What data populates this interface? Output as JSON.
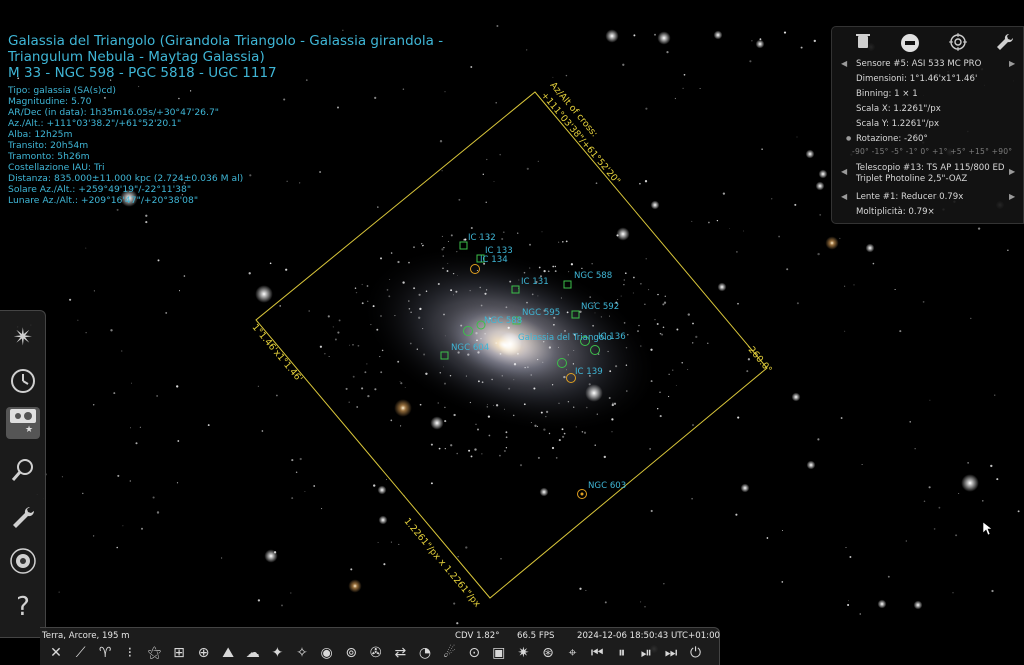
{
  "object": {
    "title_lines": [
      "Galassia del Triangolo (Girandola Triangolo - Galassia girandola -",
      "Triangulum Nebula - Maytag Galassia)",
      "M 33 - NGC 598 - PGC 5818 - UGC 1117"
    ],
    "details": [
      "Tipo: galassia (SA(s)cd)",
      "Magnitudine: 5.70",
      "AR/Dec (in data): 1h35m16.05s/+30°47'26.7\"",
      "Az./Alt.: +111°03'38.2\"/+61°52'20.1\"",
      "Alba: 12h25m",
      "Transito: 20h54m",
      "Tramonto: 5h26m",
      "Costellazione IAU: Tri",
      "Distanza: 835.000±11.000 kpc (2.724±0.036 M al)",
      "Solare Az./Alt.: +259°49'19\"/-22°11'38\"",
      "Lunare Az./Alt.: +209°16'47\"/+20°38'08\""
    ]
  },
  "frame_labels": {
    "top_right": "Az/Alt of cross:",
    "top_right_value": "+111°03'38\"/+61°52'20\"",
    "left": "1°1.46'x1°1.46'",
    "right": "-260.0°",
    "bottom": "1.2261\"/px x 1.2261\"/px"
  },
  "sky_labels": [
    {
      "text": "IC 132"
    },
    {
      "text": "IC 133"
    },
    {
      "text": "IC 134"
    },
    {
      "text": "IC 131"
    },
    {
      "text": "NGC 588"
    },
    {
      "text": "NGC 592"
    },
    {
      "text": "NGC 595"
    },
    {
      "text": "NGC 604"
    },
    {
      "text": "Galassia del Triangolo"
    },
    {
      "text": "IC 136"
    },
    {
      "text": "NGC 588"
    },
    {
      "text": "IC 139"
    },
    {
      "text": "NGC 603"
    }
  ],
  "oculars": {
    "icons": [
      "trash-icon",
      "ccd-toggle-icon",
      "crosshair-icon",
      "wrench-icon"
    ],
    "sensor": "Sensore #5: ASI 533 MC PRO",
    "dimensions": "Dimensioni: 1°1.46'x1°1.46'",
    "binning": "Binning: 1 × 1",
    "scale_x": "Scala X: 1.2261\"/px",
    "scale_y": "Scala Y: 1.2261\"/px",
    "rotation": "Rotazione: -260°",
    "rotation_steps": "-90° -15° -5° -1° 0° +1° +5° +15° +90°",
    "telescope_1": "Telescopio #13: TS AP 115/800 ED",
    "telescope_2": "Triplet Photoline 2,5\"-OAZ",
    "lens": "Lente #1: Reducer 0.79x",
    "multiplier": "Moltiplicità: 0.79×"
  },
  "status": {
    "location": "Terra, Arcore, 195 m",
    "fov": "CDV 1.82°",
    "fps": "66.5 FPS",
    "datetime": "2024-12-06 18:50:43 UTC+01:00"
  },
  "left_toolbar": [
    "sky-lore-icon",
    "time-icon",
    "sky-display-icon",
    "search-icon",
    "settings-icon",
    "astro-calc-icon",
    "help-icon"
  ],
  "bottom_toolbar": [
    "constellation-lines-icon",
    "constellation-labels-icon",
    "constellation-art-icon",
    "equatorial-grid-icon",
    "azimuthal-grid-icon",
    "ground-icon",
    "atmosphere-icon",
    "cardinal-points-icon",
    "nebulae-icon",
    "planet-labels-icon",
    "mount-mode-icon",
    "center-object-icon",
    "satellites-icon",
    "night-mode-icon",
    "fullscreen-icon",
    "exoplanets-icon",
    "meteor-showers-icon",
    "oculars-icon",
    "ocular-view-icon",
    "telescope-icon",
    "sensor-icon",
    "telrad-icon",
    "rewind-icon",
    "play-icon",
    "now-icon",
    "forward-icon",
    "quit-icon"
  ]
}
